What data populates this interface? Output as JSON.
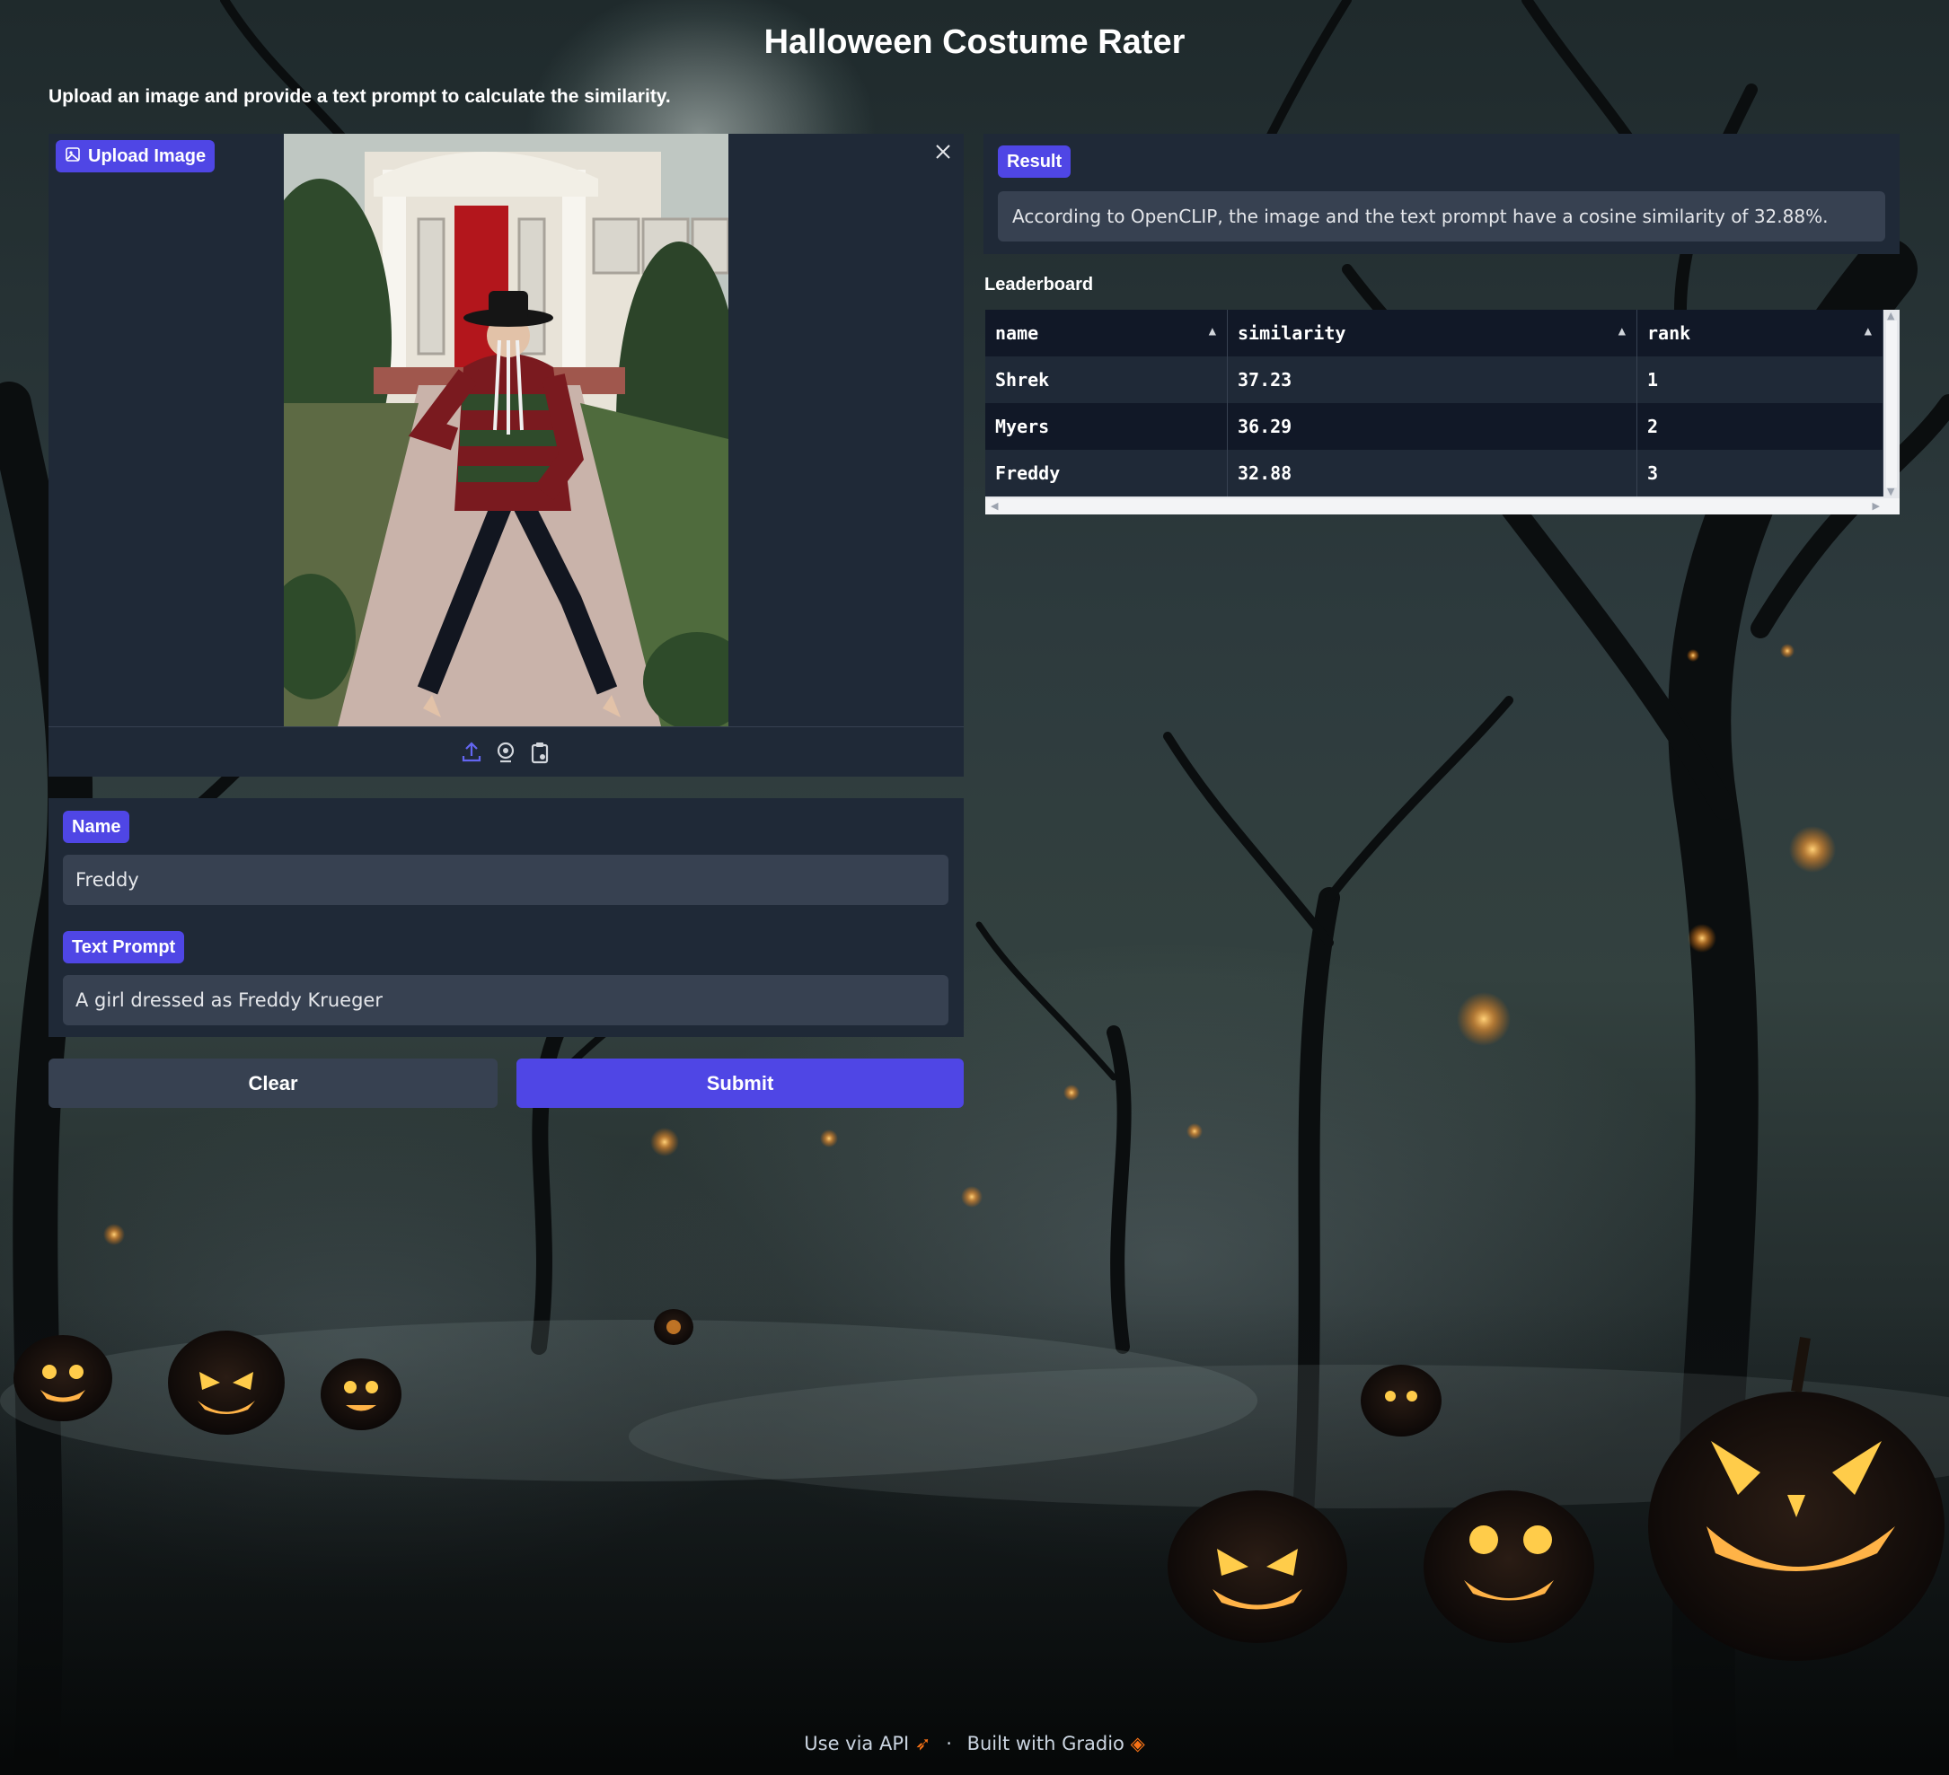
{
  "app": {
    "title": "Halloween Costume Rater",
    "description": "Upload an image and provide a text prompt to calculate the similarity."
  },
  "image_input": {
    "label": "Upload Image",
    "close_icon": "close-icon",
    "tools": [
      "upload-icon",
      "webcam-icon",
      "clipboard-icon"
    ]
  },
  "form": {
    "name_label": "Name",
    "name_value": "Freddy",
    "prompt_label": "Text Prompt",
    "prompt_value": "A girl dressed as Freddy Krueger"
  },
  "buttons": {
    "clear": "Clear",
    "submit": "Submit"
  },
  "result": {
    "label": "Result",
    "text": "According to OpenCLIP, the image and the text prompt have a cosine similarity of 32.88%."
  },
  "leaderboard": {
    "label": "Leaderboard",
    "columns": [
      "name",
      "similarity",
      "rank"
    ],
    "rows": [
      [
        "Shrek",
        "37.23",
        "1"
      ],
      [
        "Myers",
        "36.29",
        "2"
      ],
      [
        "Freddy",
        "32.88",
        "3"
      ]
    ]
  },
  "footer": {
    "api": "Use via API",
    "separator": "·",
    "built": "Built with Gradio"
  },
  "colors": {
    "accent": "#4f46e5",
    "panel": "#1f2937",
    "input": "#374151"
  }
}
